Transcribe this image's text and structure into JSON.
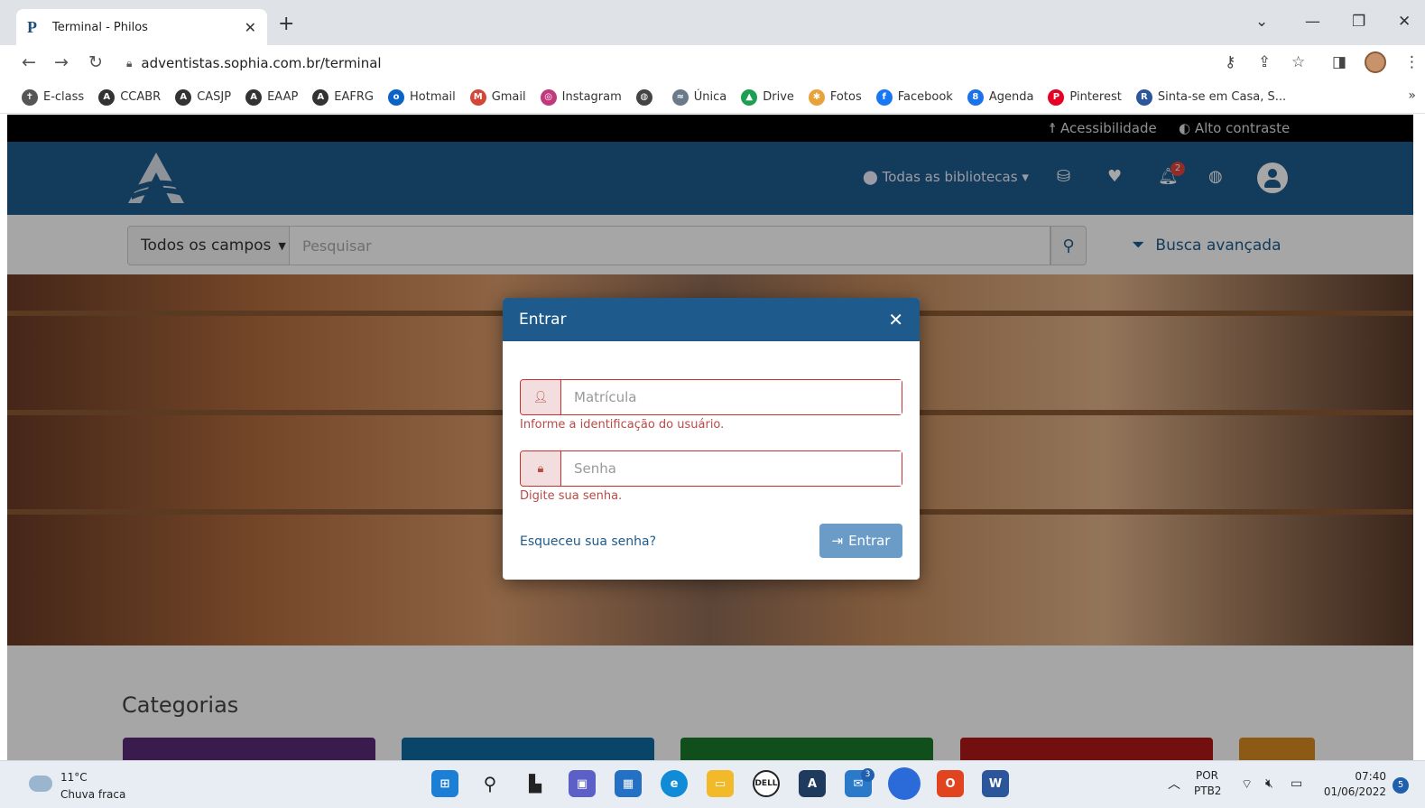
{
  "browser": {
    "tab_title": "Terminal - Philos",
    "tab_favicon": "P",
    "url": "adventistas.sophia.com.br/terminal",
    "bookmarks": [
      {
        "label": "E-class",
        "icon": "person-icon",
        "color": "#555555",
        "glyph": "✝"
      },
      {
        "label": "CCABR",
        "icon": "adventist-icon",
        "color": "#333333",
        "glyph": "A"
      },
      {
        "label": "CASJP",
        "icon": "adventist-icon",
        "color": "#333333",
        "glyph": "A"
      },
      {
        "label": "EAAP",
        "icon": "adventist-icon",
        "color": "#333333",
        "glyph": "A"
      },
      {
        "label": "EAFRG",
        "icon": "adventist-icon",
        "color": "#333333",
        "glyph": "A"
      },
      {
        "label": "Hotmail",
        "icon": "outlook-icon",
        "color": "#0a64c8",
        "glyph": "o"
      },
      {
        "label": "Gmail",
        "icon": "gmail-icon",
        "color": "#d44638",
        "glyph": "M"
      },
      {
        "label": "Instagram",
        "icon": "instagram-icon",
        "color": "#c2387c",
        "glyph": "◎"
      },
      {
        "label": "",
        "icon": "globe-icon",
        "color": "#444444",
        "glyph": "◍"
      },
      {
        "label": "Única",
        "icon": "unica-icon",
        "color": "#6a7a8a",
        "glyph": "≈"
      },
      {
        "label": "Drive",
        "icon": "drive-icon",
        "color": "#1e9e52",
        "glyph": "▲"
      },
      {
        "label": "Fotos",
        "icon": "photos-icon",
        "color": "#e8a23a",
        "glyph": "✱"
      },
      {
        "label": "Facebook",
        "icon": "facebook-icon",
        "color": "#1877f2",
        "glyph": "f"
      },
      {
        "label": "Agenda",
        "icon": "calendar-icon",
        "color": "#1a73e8",
        "glyph": "8"
      },
      {
        "label": "Pinterest",
        "icon": "pinterest-icon",
        "color": "#e60023",
        "glyph": "P"
      },
      {
        "label": "Sinta-se em Casa, S...",
        "icon": "r-icon",
        "color": "#2b579a",
        "glyph": "R"
      }
    ]
  },
  "site": {
    "accessibility_label": "Acessibilidade",
    "contrast_label": "Alto contraste",
    "library_select": "Todas as bibliotecas",
    "notification_count": "2",
    "search": {
      "field_select": "Todos os campos",
      "placeholder": "Pesquisar",
      "advanced_label": "Busca avançada"
    },
    "categories_title": "Categorias",
    "category_colors": [
      "#5a2a78",
      "#0e6aa0",
      "#1a7a2a",
      "#b01818",
      "#d88a20"
    ]
  },
  "modal": {
    "title": "Entrar",
    "matricula_placeholder": "Matrícula",
    "matricula_help": "Informe a identificação do usuário.",
    "senha_placeholder": "Senha",
    "senha_help": "Digite sua senha.",
    "forgot_label": "Esqueceu sua senha?",
    "submit_label": "Entrar"
  },
  "taskbar": {
    "temperature": "11°C",
    "weather": "Chuva fraca",
    "mail_badge": "3",
    "language": "POR",
    "layout": "PTB2",
    "time": "07:40",
    "date": "01/06/2022",
    "notifications": "5"
  }
}
